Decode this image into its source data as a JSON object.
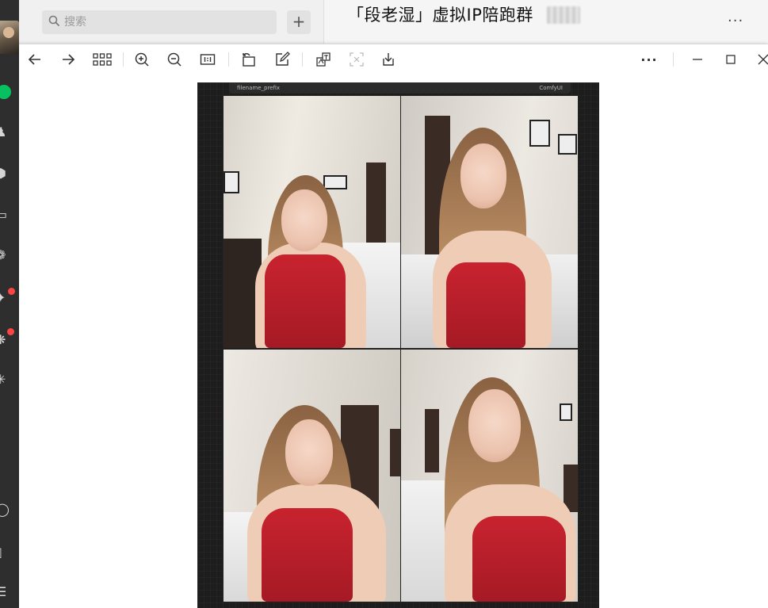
{
  "sidebar": {
    "avatar": "avatar",
    "status": "online-dot",
    "icons": [
      "contacts-icon",
      "cube-icon",
      "folder-icon",
      "moments-icon",
      "channels-icon",
      "miniprogram-icon",
      "search-discover-icon",
      "mini-apps-icon",
      "phone-icon",
      "menu-icon"
    ]
  },
  "chat_list": {
    "search_placeholder": "搜索",
    "add_label": "+"
  },
  "chat": {
    "title": "「段老湿」虚拟IP陪跑群",
    "more_label": "···"
  },
  "viewer": {
    "toolbar_icons": [
      "back-icon",
      "forward-icon",
      "grid-icon",
      "zoom-in-icon",
      "zoom-out-icon",
      "actual-size-icon",
      "rotate-icon",
      "edit-icon",
      "translate-icon",
      "extract-text-icon",
      "download-icon",
      "more-icon",
      "minimize-icon",
      "maximize-icon",
      "close-icon"
    ],
    "more_label": "···",
    "image": {
      "node_label_left": "filename_prefix",
      "node_label_right": "ComfyUI"
    }
  },
  "colors": {
    "sidebar_bg": "#2e2e2e",
    "green": "#07c160",
    "dress_red": "#c8232f"
  }
}
